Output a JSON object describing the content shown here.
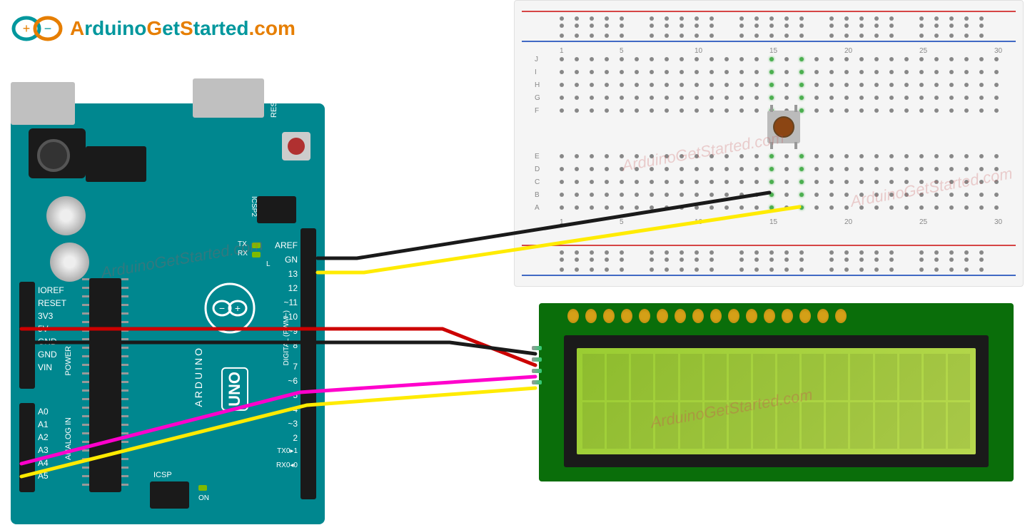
{
  "logo": {
    "text_parts": [
      "A",
      "rduino",
      "G",
      "et",
      "S",
      "tarted",
      ".com"
    ],
    "text": "ArduinoGetStarted.com"
  },
  "watermark": "ArduinoGetStarted.com",
  "arduino": {
    "reset": "RESET",
    "icsp2": "ICSP2",
    "icsp": "ICSP",
    "brand": "ARDUINO",
    "model": "UNO",
    "power_label": "POWER",
    "analog_label": "ANALOG IN",
    "digital_label": "DIGITAL (PWM~)",
    "tx": "TX",
    "rx": "RX",
    "l": "L",
    "on": "ON",
    "pins_right": [
      "AREF",
      "GN",
      "13",
      "12",
      "~11",
      "~10",
      "~9",
      "8",
      "7",
      "~6",
      "~5",
      "4",
      "~3",
      "2",
      "TX0▸1",
      "RX0◂0"
    ],
    "pins_left_power": [
      "IOREF",
      "RESET",
      "3V3",
      "5V",
      "GND",
      "GND",
      "VIN"
    ],
    "pins_left_analog": [
      "A0",
      "A1",
      "A2",
      "A3",
      "A4",
      "A5"
    ]
  },
  "breadboard": {
    "row_labels_top": [
      "J",
      "I",
      "H",
      "G",
      "F"
    ],
    "row_labels_bot": [
      "E",
      "D",
      "C",
      "B",
      "A"
    ],
    "col_labels": [
      "1",
      "5",
      "10",
      "15",
      "20",
      "25",
      "30"
    ]
  },
  "lcd": {
    "pin_count": 16,
    "side_pin_count": 4,
    "cols": 16,
    "rows": 2
  },
  "wires": [
    {
      "name": "gnd-to-button",
      "color": "#1a1a1a",
      "from": "arduino-GND-digital",
      "to": "breadboard-15A"
    },
    {
      "name": "d13-to-button",
      "color": "#ffeb00",
      "from": "arduino-13",
      "to": "breadboard-17A"
    },
    {
      "name": "5v-to-lcd-vcc",
      "color": "#cc0000",
      "from": "arduino-5V",
      "to": "lcd-VCC"
    },
    {
      "name": "gnd-to-lcd-gnd",
      "color": "#1a1a1a",
      "from": "arduino-GND-power",
      "to": "lcd-GND"
    },
    {
      "name": "a4-to-lcd-sda",
      "color": "#ff00cc",
      "from": "arduino-A4",
      "to": "lcd-SDA"
    },
    {
      "name": "a5-to-lcd-scl",
      "color": "#ffeb00",
      "from": "arduino-A5",
      "to": "lcd-SCL"
    }
  ]
}
